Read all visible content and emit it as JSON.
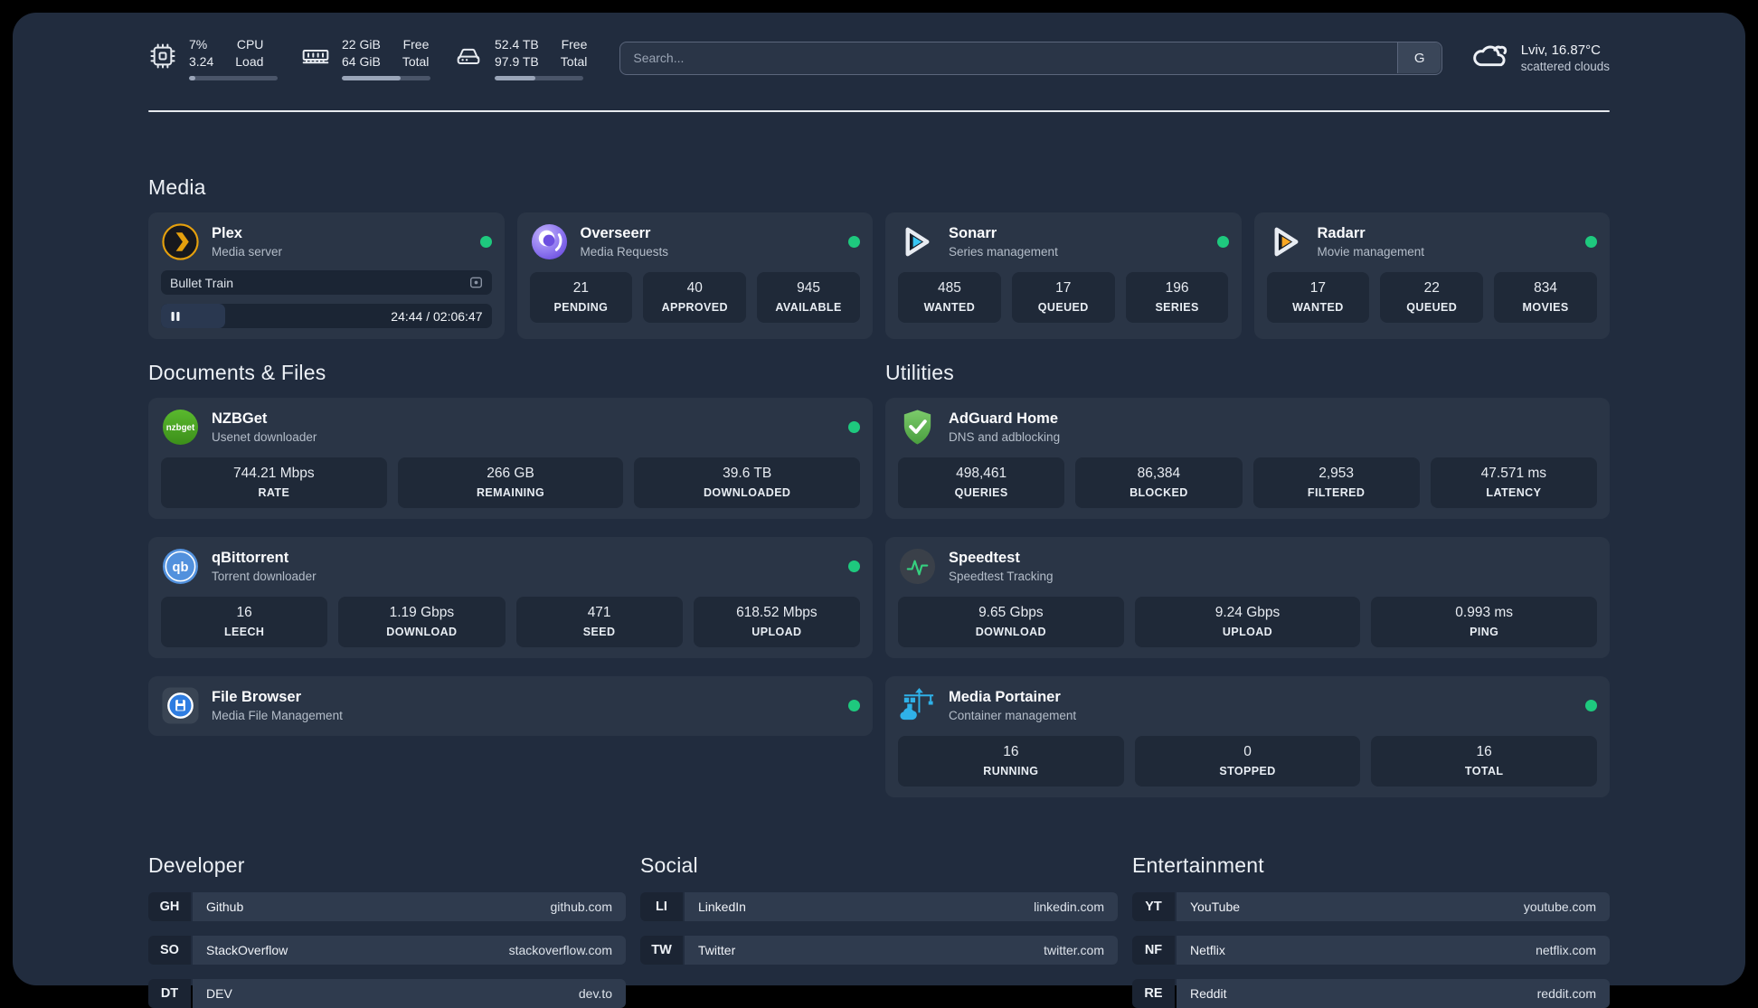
{
  "colors": {
    "page_bg": "#000000",
    "panel_bg": "#212c3e",
    "card_bg": "#2a3546",
    "tile_bg": "#1f2938",
    "status_online": "#1ec97e",
    "plex_amber": "#e5a00d",
    "sonarr_cyan": "#38c6f4",
    "radarr_amber": "#f9a825",
    "adguard_green": "#5fae4e",
    "portainer_blue": "#2fb1e8"
  },
  "header": {
    "hardware": [
      {
        "icon": "cpu-icon",
        "values": [
          "7%",
          "3.24"
        ],
        "labels": [
          "CPU",
          "Load"
        ],
        "usage_pct": 7
      },
      {
        "icon": "ram-icon",
        "values": [
          "22 GiB",
          "64 GiB"
        ],
        "labels": [
          "Free",
          "Total"
        ],
        "usage_pct": 66
      },
      {
        "icon": "disk-icon",
        "values": [
          "52.4 TB",
          "97.9 TB"
        ],
        "labels": [
          "Free",
          "Total"
        ],
        "usage_pct": 46
      }
    ],
    "search": {
      "placeholder": "Search...",
      "engine_button": "G"
    },
    "weather": {
      "icon": "cloud-icon",
      "location_temp": "Lviv, 16.87°C",
      "condition": "scattered clouds"
    }
  },
  "media": {
    "title": "Media",
    "plex": {
      "icon": "plex-icon",
      "title": "Plex",
      "subtitle": "Media server",
      "online": true,
      "now_playing": "Bullet Train",
      "time_display": "24:44 / 02:06:47",
      "progress_pct": 19.5
    },
    "overseerr": {
      "icon": "overseerr-icon",
      "title": "Overseerr",
      "subtitle": "Media Requests",
      "online": true,
      "stats": [
        {
          "value": "21",
          "label": "PENDING"
        },
        {
          "value": "40",
          "label": "APPROVED"
        },
        {
          "value": "945",
          "label": "AVAILABLE"
        }
      ]
    },
    "sonarr": {
      "icon": "sonarr-icon",
      "title": "Sonarr",
      "subtitle": "Series management",
      "online": true,
      "stats": [
        {
          "value": "485",
          "label": "WANTED"
        },
        {
          "value": "17",
          "label": "QUEUED"
        },
        {
          "value": "196",
          "label": "SERIES"
        }
      ]
    },
    "radarr": {
      "icon": "radarr-icon",
      "title": "Radarr",
      "subtitle": "Movie management",
      "online": true,
      "stats": [
        {
          "value": "17",
          "label": "WANTED"
        },
        {
          "value": "22",
          "label": "QUEUED"
        },
        {
          "value": "834",
          "label": "MOVIES"
        }
      ]
    }
  },
  "documents": {
    "title": "Documents & Files",
    "nzbget": {
      "icon": "nzbget-icon",
      "title": "NZBGet",
      "subtitle": "Usenet downloader",
      "online": true,
      "stats": [
        {
          "value": "744.21 Mbps",
          "label": "RATE"
        },
        {
          "value": "266 GB",
          "label": "REMAINING"
        },
        {
          "value": "39.6 TB",
          "label": "DOWNLOADED"
        }
      ]
    },
    "qbittorrent": {
      "icon": "qbittorrent-icon",
      "title": "qBittorrent",
      "subtitle": "Torrent downloader",
      "online": true,
      "stats": [
        {
          "value": "16",
          "label": "LEECH"
        },
        {
          "value": "1.19 Gbps",
          "label": "DOWNLOAD"
        },
        {
          "value": "471",
          "label": "SEED"
        },
        {
          "value": "618.52 Mbps",
          "label": "UPLOAD"
        }
      ]
    },
    "filebrowser": {
      "icon": "filebrowser-icon",
      "title": "File Browser",
      "subtitle": "Media File Management",
      "online": true
    }
  },
  "utilities": {
    "title": "Utilities",
    "adguard": {
      "icon": "adguard-icon",
      "title": "AdGuard Home",
      "subtitle": "DNS and adblocking",
      "stats": [
        {
          "value": "498,461",
          "label": "QUERIES"
        },
        {
          "value": "86,384",
          "label": "BLOCKED"
        },
        {
          "value": "2,953",
          "label": "FILTERED"
        },
        {
          "value": "47.571 ms",
          "label": "LATENCY"
        }
      ]
    },
    "speedtest": {
      "icon": "speedtest-icon",
      "title": "Speedtest",
      "subtitle": "Speedtest Tracking",
      "stats": [
        {
          "value": "9.65 Gbps",
          "label": "DOWNLOAD"
        },
        {
          "value": "9.24 Gbps",
          "label": "UPLOAD"
        },
        {
          "value": "0.993 ms",
          "label": "PING"
        }
      ]
    },
    "portainer": {
      "icon": "portainer-icon",
      "title": "Media Portainer",
      "subtitle": "Container management",
      "online": true,
      "stats": [
        {
          "value": "16",
          "label": "RUNNING"
        },
        {
          "value": "0",
          "label": "STOPPED"
        },
        {
          "value": "16",
          "label": "TOTAL"
        }
      ]
    }
  },
  "links": {
    "developer": {
      "title": "Developer",
      "items": [
        {
          "abbr": "GH",
          "name": "Github",
          "url": "github.com"
        },
        {
          "abbr": "SO",
          "name": "StackOverflow",
          "url": "stackoverflow.com"
        },
        {
          "abbr": "DT",
          "name": "DEV",
          "url": "dev.to"
        }
      ]
    },
    "social": {
      "title": "Social",
      "items": [
        {
          "abbr": "LI",
          "name": "LinkedIn",
          "url": "linkedin.com"
        },
        {
          "abbr": "TW",
          "name": "Twitter",
          "url": "twitter.com"
        }
      ]
    },
    "entertainment": {
      "title": "Entertainment",
      "items": [
        {
          "abbr": "YT",
          "name": "YouTube",
          "url": "youtube.com"
        },
        {
          "abbr": "NF",
          "name": "Netflix",
          "url": "netflix.com"
        },
        {
          "abbr": "RE",
          "name": "Reddit",
          "url": "reddit.com"
        }
      ]
    }
  }
}
